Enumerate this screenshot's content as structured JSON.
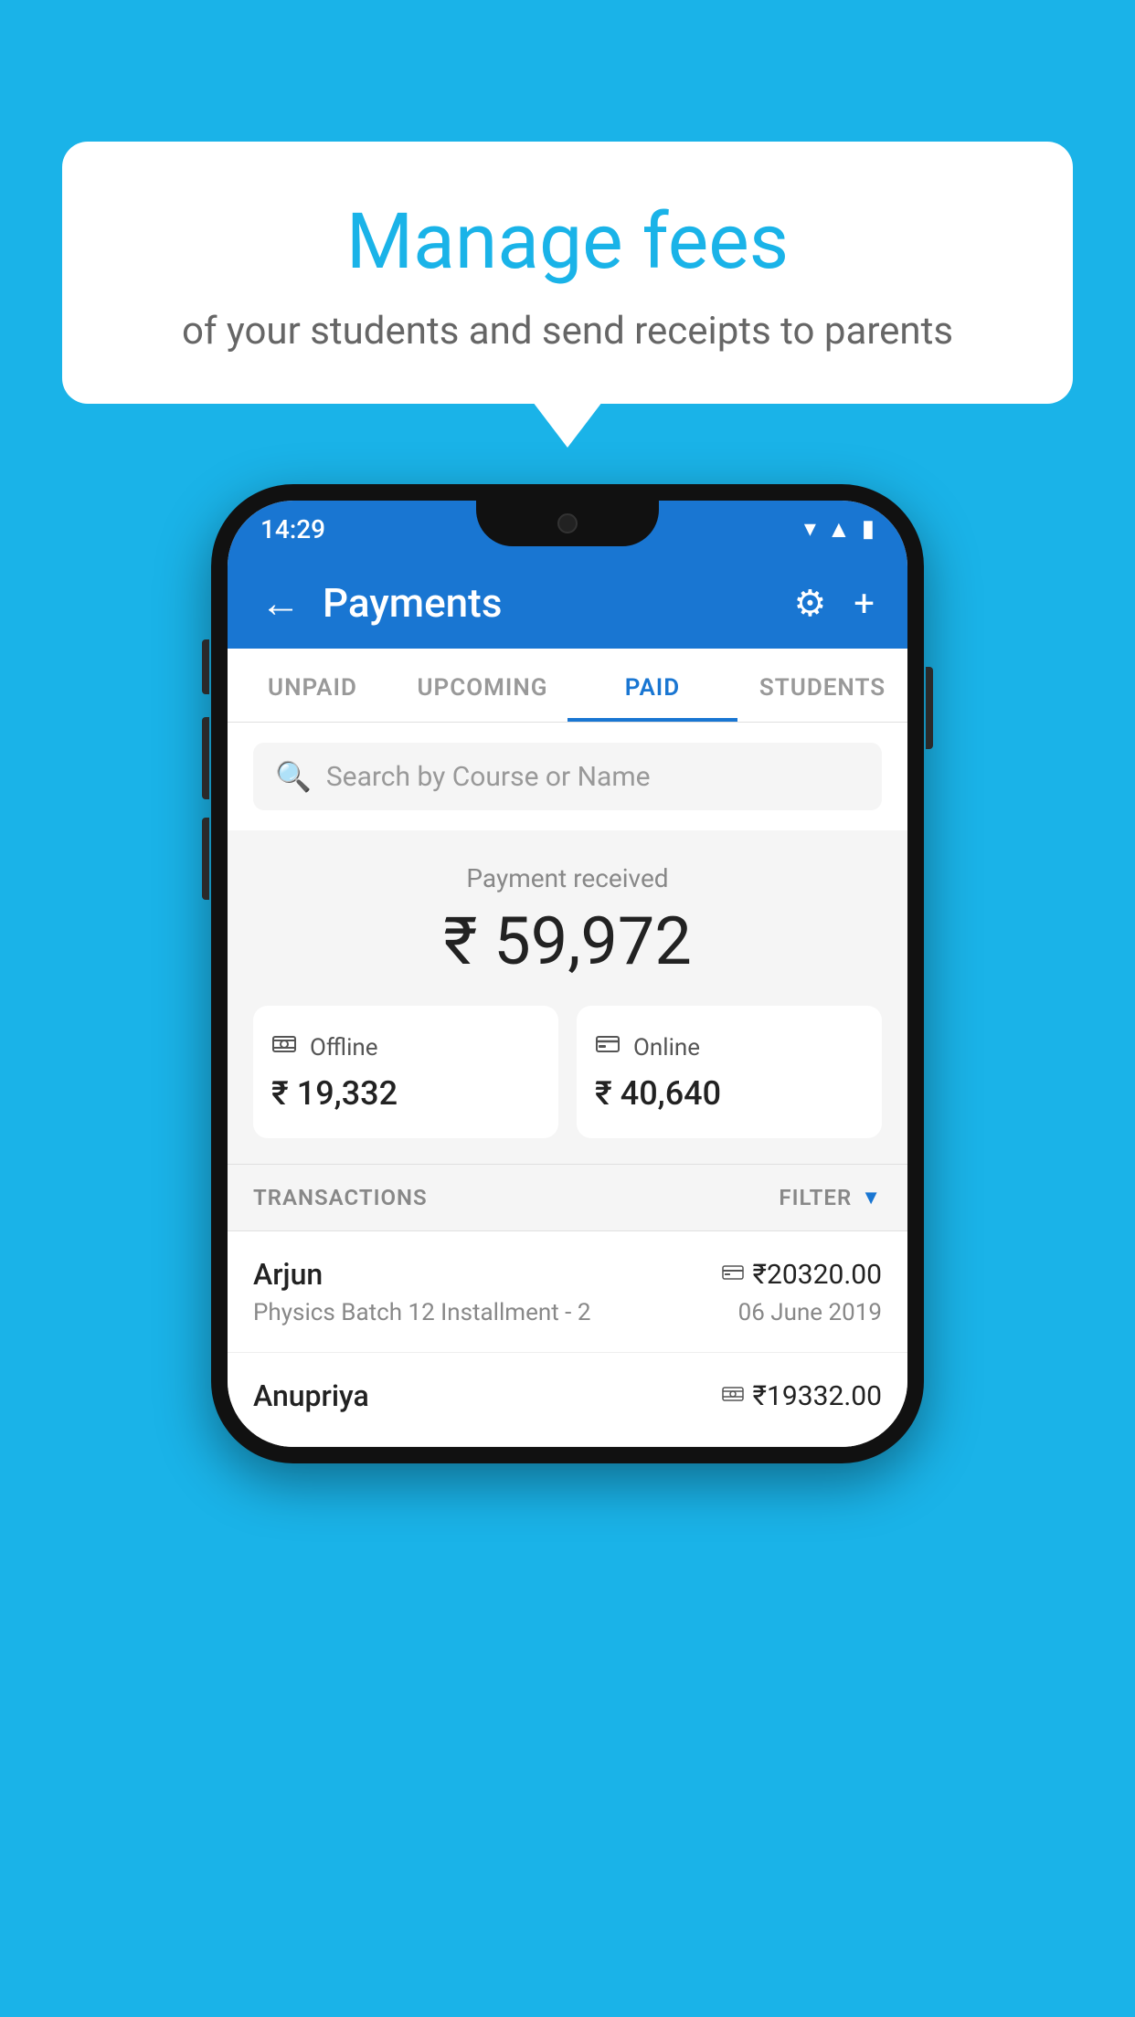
{
  "page": {
    "background_color": "#1ab3e8"
  },
  "bubble": {
    "title": "Manage fees",
    "subtitle": "of your students and send receipts to parents"
  },
  "status_bar": {
    "time": "14:29",
    "wifi_icon": "▾",
    "signal_icon": "▲",
    "battery_icon": "▮"
  },
  "header": {
    "back_label": "←",
    "title": "Payments",
    "gear_label": "⚙",
    "plus_label": "+"
  },
  "tabs": [
    {
      "id": "unpaid",
      "label": "UNPAID",
      "active": false
    },
    {
      "id": "upcoming",
      "label": "UPCOMING",
      "active": false
    },
    {
      "id": "paid",
      "label": "PAID",
      "active": true
    },
    {
      "id": "students",
      "label": "STUDENTS",
      "active": false
    }
  ],
  "search": {
    "placeholder": "Search by Course or Name"
  },
  "payment_summary": {
    "received_label": "Payment received",
    "total_amount": "₹ 59,972",
    "offline": {
      "label": "Offline",
      "amount": "₹ 19,332"
    },
    "online": {
      "label": "Online",
      "amount": "₹ 40,640"
    }
  },
  "transactions": {
    "header_label": "TRANSACTIONS",
    "filter_label": "FILTER",
    "items": [
      {
        "name": "Arjun",
        "detail": "Physics Batch 12 Installment - 2",
        "amount": "₹20320.00",
        "date": "06 June 2019",
        "type": "online"
      },
      {
        "name": "Anupriya",
        "detail": "",
        "amount": "₹19332.00",
        "date": "",
        "type": "offline"
      }
    ]
  }
}
